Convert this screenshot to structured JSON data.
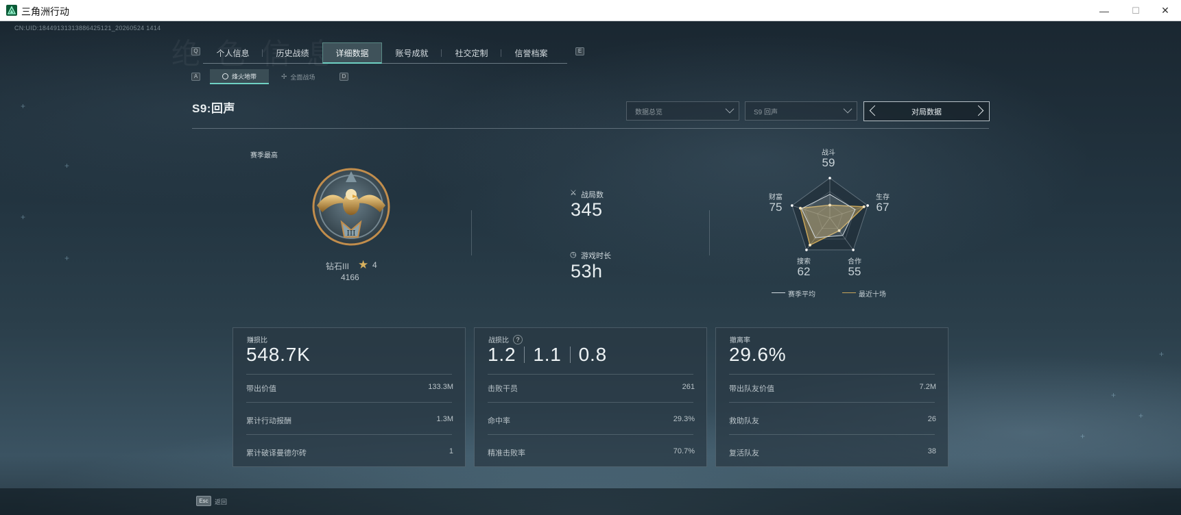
{
  "window": {
    "title": "三角洲行动",
    "minimize": "—",
    "maximize": "☐",
    "close": "✕"
  },
  "uid": "CN:UID:18449131313886425121_20260524 1414",
  "tabs": {
    "left_key": "Q",
    "right_key": "E",
    "items": [
      {
        "label": "个人信息"
      },
      {
        "label": "历史战绩"
      },
      {
        "label": "详细数据",
        "active": true
      },
      {
        "label": "账号成就"
      },
      {
        "label": "社交定制"
      },
      {
        "label": "信誉档案"
      }
    ]
  },
  "subtabs": {
    "left_key": "A",
    "right_key": "D",
    "items": [
      {
        "label": "烽火地带",
        "active": true
      },
      {
        "label": "全面战场"
      }
    ]
  },
  "season": {
    "title": "S9:回声"
  },
  "filters": {
    "data_select": "数据总览",
    "season_select": "S9 回声",
    "nav_label": "对局数据"
  },
  "rank": {
    "label": "赛季最高",
    "name": "钻石III",
    "stars": "4",
    "points": "4166",
    "badge_numeral": "III"
  },
  "stats": {
    "matches_label": "战局数",
    "matches_value": "345",
    "playtime_label": "游戏时长",
    "playtime_value": "53h"
  },
  "radar": {
    "axes": [
      {
        "name": "战斗",
        "value": 59,
        "recent": 32
      },
      {
        "name": "生存",
        "value": 67,
        "recent": 90
      },
      {
        "name": "合作",
        "value": 55,
        "recent": 40
      },
      {
        "name": "搜索",
        "value": 62,
        "recent": 85
      },
      {
        "name": "财富",
        "value": 75,
        "recent": 78
      }
    ],
    "legend_avg": "赛季平均",
    "legend_recent": "最近十场",
    "avg_color": "#d3dbe0",
    "recent_color": "#c9a65a"
  },
  "cards": [
    {
      "title": "赚损比",
      "big": "548.7K",
      "rows": [
        {
          "label": "带出价值",
          "value": "133.3M"
        },
        {
          "label": "累计行动报酬",
          "value": "1.3M"
        },
        {
          "label": "累计破译曼德尔砖",
          "value": "1"
        }
      ]
    },
    {
      "title": "战损比",
      "help": "?",
      "big_parts": [
        "1.2",
        "1.1",
        "0.8"
      ],
      "rows": [
        {
          "label": "击败干员",
          "value": "261"
        },
        {
          "label": "命中率",
          "value": "29.3%"
        },
        {
          "label": "精准击败率",
          "value": "70.7%"
        }
      ]
    },
    {
      "title": "撤离率",
      "big": "29.6%",
      "rows": [
        {
          "label": "带出队友价值",
          "value": "7.2M"
        },
        {
          "label": "救助队友",
          "value": "26"
        },
        {
          "label": "复活队友",
          "value": "38"
        }
      ]
    }
  ],
  "footer": {
    "esc_key": "Esc",
    "esc_label": "返回"
  }
}
